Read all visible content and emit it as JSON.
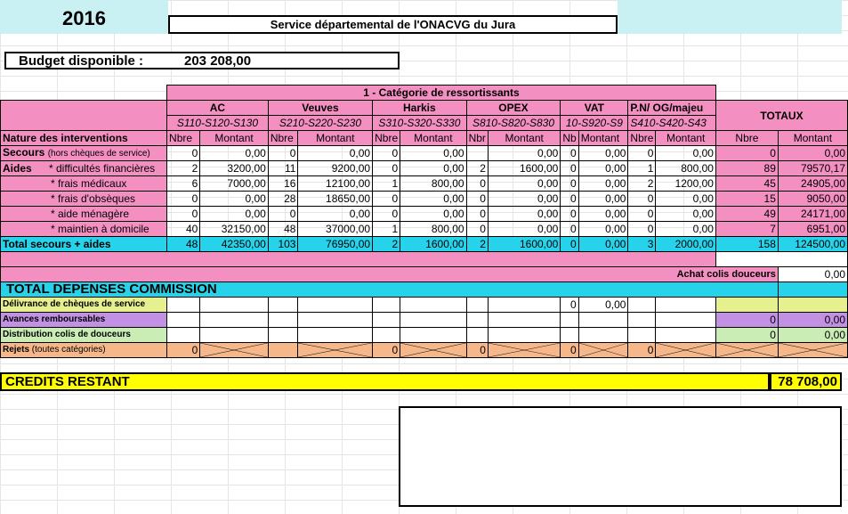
{
  "year": "2016",
  "service_title": "Service départemental de l'ONACVG du Jura",
  "budget": {
    "label": "Budget disponible :",
    "value": "203 208,00"
  },
  "category_header": "1 - Catégorie de ressortissants",
  "columns": [
    {
      "name": "AC",
      "codes": "S110-S120-S130"
    },
    {
      "name": "Veuves",
      "codes": "S210-S220-S230"
    },
    {
      "name": "Harkis",
      "codes": "S310-S320-S330"
    },
    {
      "name": "OPEX",
      "codes": "S810-S820-S830"
    },
    {
      "name": "VAT",
      "codes": "10-S920-S9"
    },
    {
      "name": "P.N/ OG/majeu",
      "codes": "S410-S420-S43"
    }
  ],
  "totaux_label": "TOTAUX",
  "nature_label": "Nature des interventions",
  "sub_headers": {
    "nbre": "Nbre",
    "montant": "Montant",
    "nbr": "Nbr",
    "nb": "Nb",
    "nbre_short": "Nbre"
  },
  "rows": [
    {
      "label": "Secours",
      "label_small": "(hors chèques de service)",
      "values": [
        "0",
        "0,00",
        "0",
        "0,00",
        "0",
        "0,00",
        "",
        "0,00",
        "0",
        "0,00",
        "0",
        "0,00"
      ],
      "total_n": "0",
      "total_m": "0,00"
    },
    {
      "label": "Aides",
      "sub": "* difficultés financières",
      "values": [
        "2",
        "3200,00",
        "11",
        "9200,00",
        "0",
        "0,00",
        "2",
        "1600,00",
        "0",
        "0,00",
        "1",
        "800,00"
      ],
      "total_n": "89",
      "total_m": "79570,17"
    },
    {
      "sub": "* frais médicaux",
      "values": [
        "6",
        "7000,00",
        "16",
        "12100,00",
        "1",
        "800,00",
        "0",
        "0,00",
        "0",
        "0,00",
        "2",
        "1200,00"
      ],
      "total_n": "45",
      "total_m": "24905,00"
    },
    {
      "sub": "* frais d'obsèques",
      "values": [
        "0",
        "0,00",
        "28",
        "18650,00",
        "0",
        "0,00",
        "0",
        "0,00",
        "0",
        "0,00",
        "0",
        "0,00"
      ],
      "total_n": "15",
      "total_m": "9050,00"
    },
    {
      "sub": "* aide ménagère",
      "values": [
        "0",
        "0,00",
        "0",
        "0,00",
        "0",
        "0,00",
        "0",
        "0,00",
        "0",
        "0,00",
        "0",
        "0,00"
      ],
      "total_n": "49",
      "total_m": "24171,00"
    },
    {
      "sub": "* maintien à domicile",
      "values": [
        "40",
        "32150,00",
        "48",
        "37000,00",
        "1",
        "800,00",
        "0",
        "0,00",
        "0",
        "0,00",
        "0",
        "0,00"
      ],
      "total_n": "7",
      "total_m": "6951,00"
    }
  ],
  "total_row": {
    "label": "Total secours + aides",
    "values": [
      "48",
      "42350,00",
      "103",
      "76950,00",
      "2",
      "1600,00",
      "2",
      "1600,00",
      "0",
      "0,00",
      "3",
      "2000,00"
    ],
    "total_n": "158",
    "total_m": "124500,00"
  },
  "achat": {
    "label": "Achat colis douceurs",
    "value": "0,00"
  },
  "commission_label": "TOTAL DEPENSES COMMISSION",
  "lower_rows": [
    {
      "label": "Délivrance de chèques de service",
      "vat_n": "0",
      "vat_m": "0,00",
      "total_n": "",
      "total_m": ""
    },
    {
      "label": "Avances remboursables",
      "total_n": "0",
      "total_m": "0,00"
    },
    {
      "label": "Distribution  colis de douceurs",
      "total_n": "0",
      "total_m": "0,00"
    },
    {
      "label": "Rejets",
      "label_small": "(toutes catégories)",
      "zeros": [
        "0",
        "0",
        "0",
        "0",
        "0"
      ]
    }
  ],
  "credits": {
    "label": "CREDITS RESTANT",
    "value": "78 708,00"
  }
}
